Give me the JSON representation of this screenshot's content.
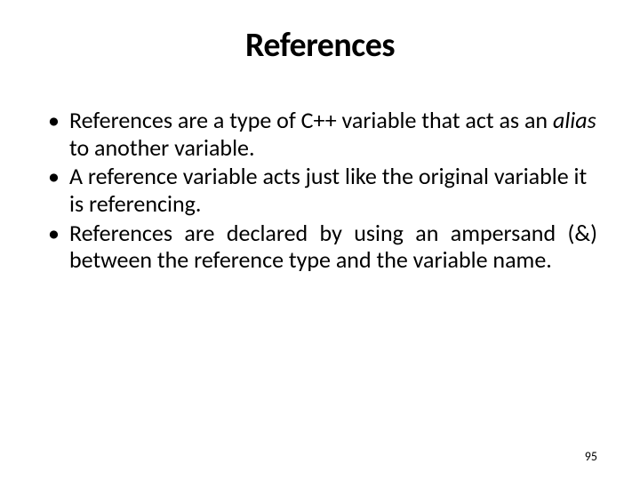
{
  "title": "References",
  "bullets": [
    {
      "pre": "References are a type of C++ variable that act as an ",
      "italic": "alias",
      "post": " to another variable.",
      "justify": false
    },
    {
      "pre": "A reference variable acts just like the original variable it is referencing.",
      "italic": "",
      "post": "",
      "justify": false
    },
    {
      "pre": "References are declared by using an ampersand (&) between the reference type and the variable name.",
      "italic": "",
      "post": "",
      "justify": true
    }
  ],
  "pageNumber": "95"
}
